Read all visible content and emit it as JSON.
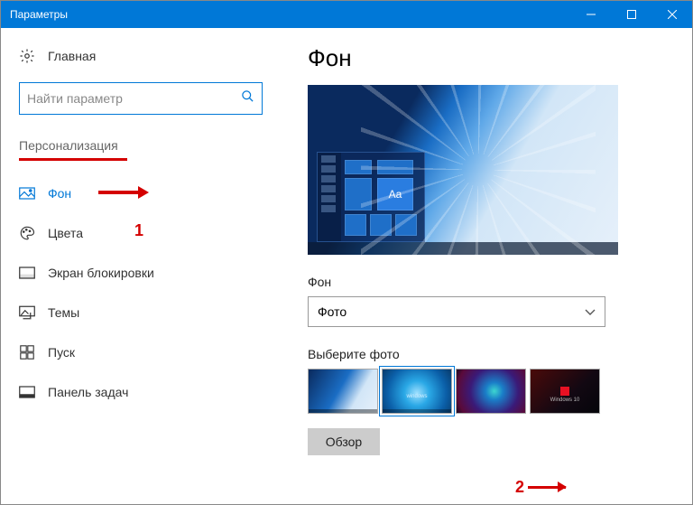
{
  "window": {
    "title": "Параметры"
  },
  "sidebar": {
    "home": "Главная",
    "searchPlaceholder": "Найти параметр",
    "category": "Персонализация",
    "items": [
      {
        "label": "Фон",
        "icon": "picture-icon",
        "active": true
      },
      {
        "label": "Цвета",
        "icon": "palette-icon",
        "active": false
      },
      {
        "label": "Экран блокировки",
        "icon": "lockscreen-icon",
        "active": false
      },
      {
        "label": "Темы",
        "icon": "themes-icon",
        "active": false
      },
      {
        "label": "Пуск",
        "icon": "start-icon",
        "active": false
      },
      {
        "label": "Панель задач",
        "icon": "taskbar-icon",
        "active": false
      }
    ]
  },
  "content": {
    "title": "Фон",
    "previewSample": "Aa",
    "backgroundLabel": "Фон",
    "backgroundValue": "Фото",
    "choosePhotoLabel": "Выберите фото",
    "browse": "Обзор"
  },
  "annotations": {
    "one": "1",
    "two": "2"
  }
}
